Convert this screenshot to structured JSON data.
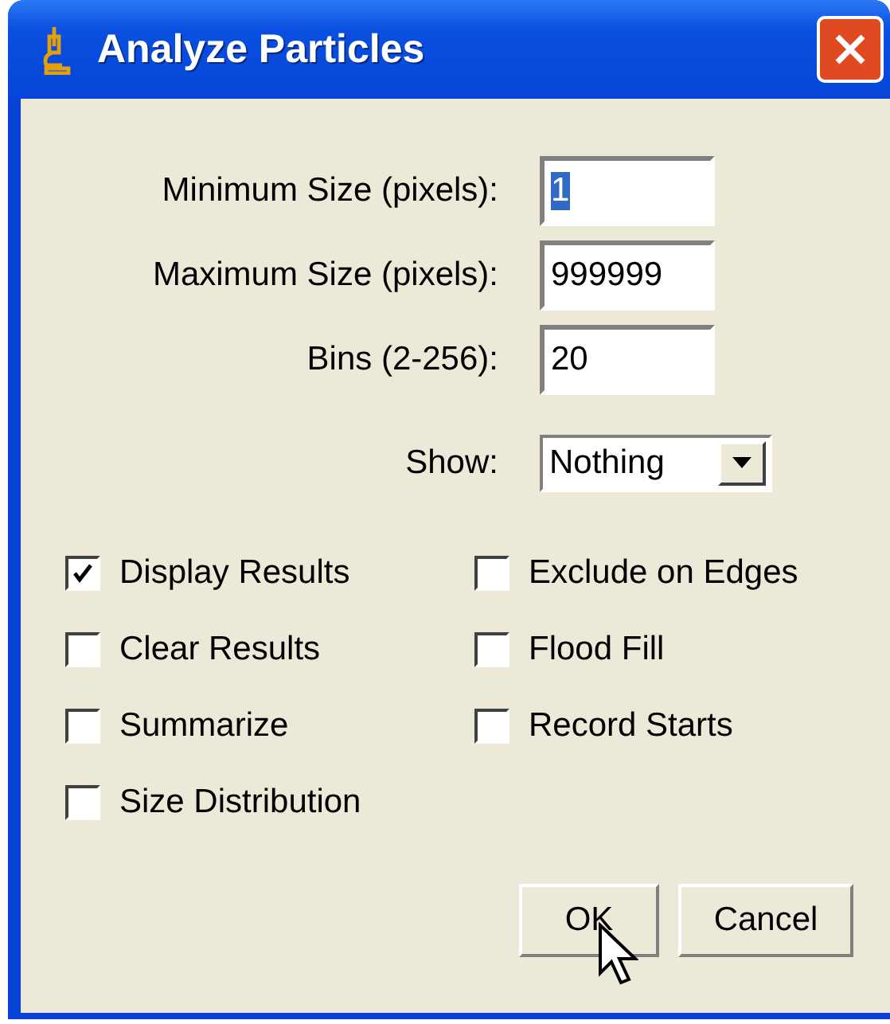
{
  "window": {
    "title": "Analyze Particles"
  },
  "fields": [
    {
      "label": "Minimum Size (pixels):",
      "value": "1",
      "text_selected": true
    },
    {
      "label": "Maximum Size (pixels):",
      "value": "999999",
      "text_selected": false
    },
    {
      "label": "Bins (2-256):",
      "value": "20",
      "text_selected": false
    }
  ],
  "show": {
    "label": "Show:",
    "value": "Nothing"
  },
  "checkboxes": [
    {
      "label": "Display Results",
      "checked": true
    },
    {
      "label": "Exclude on Edges",
      "checked": false
    },
    {
      "label": "Clear Results",
      "checked": false
    },
    {
      "label": "Flood Fill",
      "checked": false
    },
    {
      "label": "Summarize",
      "checked": false
    },
    {
      "label": "Record Starts",
      "checked": false
    },
    {
      "label": "Size Distribution",
      "checked": false
    }
  ],
  "buttons": [
    "OK",
    "Cancel"
  ]
}
